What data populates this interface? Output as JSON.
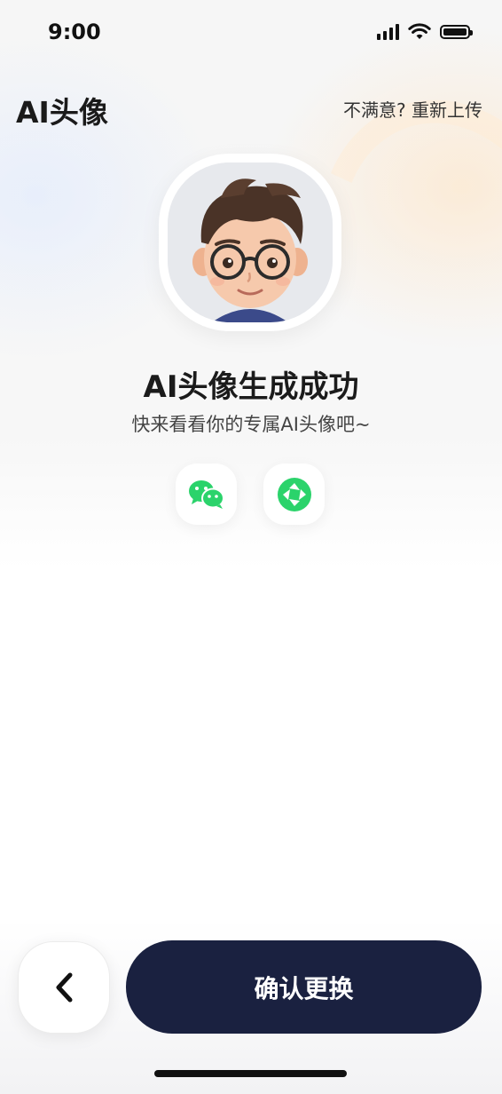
{
  "status_bar": {
    "time": "9:00"
  },
  "header": {
    "title": "AI头像",
    "reupload_link": "不满意? 重新上传"
  },
  "avatar": {
    "icon": "avatar-icon"
  },
  "result": {
    "title": "AI头像生成成功",
    "subtitle": "快来看看你的专属AI头像吧~"
  },
  "share": {
    "wechat_icon": "wechat-icon",
    "moments_icon": "moments-icon"
  },
  "footer": {
    "back_icon": "chevron-left-icon",
    "confirm_label": "确认更换"
  },
  "colors": {
    "primary_button": "#1a2140",
    "wechat_green": "#2bd36b"
  }
}
